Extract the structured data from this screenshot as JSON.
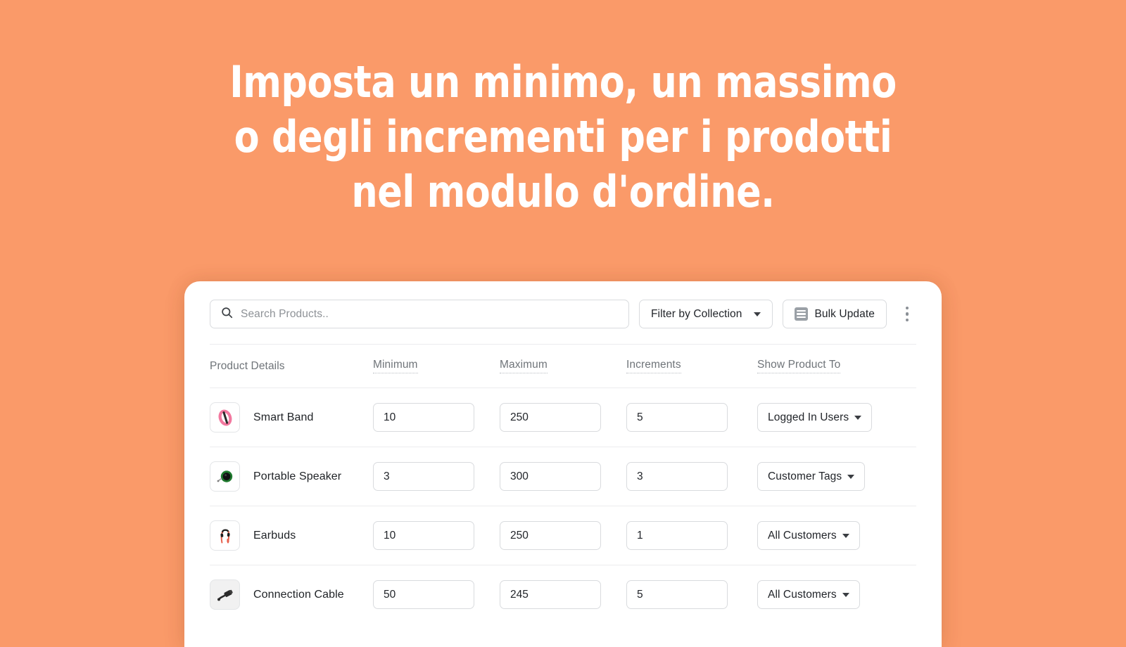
{
  "theme": {
    "background": "#FA9A69",
    "card_background": "#FFFFFF",
    "heading_color": "#FFFFFF",
    "border_color": "#D9DBDE",
    "muted_text": "#6F7479",
    "text_color": "#22252A"
  },
  "hero": {
    "title": "Imposta un minimo, un massimo o degli incrementi per i prodotti nel modulo d'ordine."
  },
  "toolbar": {
    "search": {
      "icon": "search-icon",
      "placeholder": "Search Products..",
      "value": ""
    },
    "filter_button": {
      "label": "Filter by Collection",
      "icon": "chevron-down-icon"
    },
    "bulk_update_button": {
      "label": "Bulk Update",
      "icon": "list-icon"
    },
    "overflow_menu": {
      "icon": "kebab-menu-icon"
    }
  },
  "table": {
    "headers": [
      {
        "label": "Product Details",
        "hinted": false
      },
      {
        "label": "Minimum",
        "hinted": true
      },
      {
        "label": "Maximum",
        "hinted": true
      },
      {
        "label": "Increments",
        "hinted": true
      },
      {
        "label": "Show Product To",
        "hinted": true
      }
    ],
    "rows": [
      {
        "thumbnail": "smart-band-thumbnail",
        "name": "Smart Band",
        "minimum": "10",
        "maximum": "250",
        "increments": "5",
        "show_product_to": "Logged In Users"
      },
      {
        "thumbnail": "portable-speaker-thumbnail",
        "name": "Portable Speaker",
        "minimum": "3",
        "maximum": "300",
        "increments": "3",
        "show_product_to": "Customer Tags"
      },
      {
        "thumbnail": "earbuds-thumbnail",
        "name": "Earbuds",
        "minimum": "10",
        "maximum": "250",
        "increments": "1",
        "show_product_to": "All Customers"
      },
      {
        "thumbnail": "connection-cable-thumbnail",
        "name": "Connection Cable",
        "minimum": "50",
        "maximum": "245",
        "increments": "5",
        "show_product_to": "All Customers"
      }
    ]
  }
}
